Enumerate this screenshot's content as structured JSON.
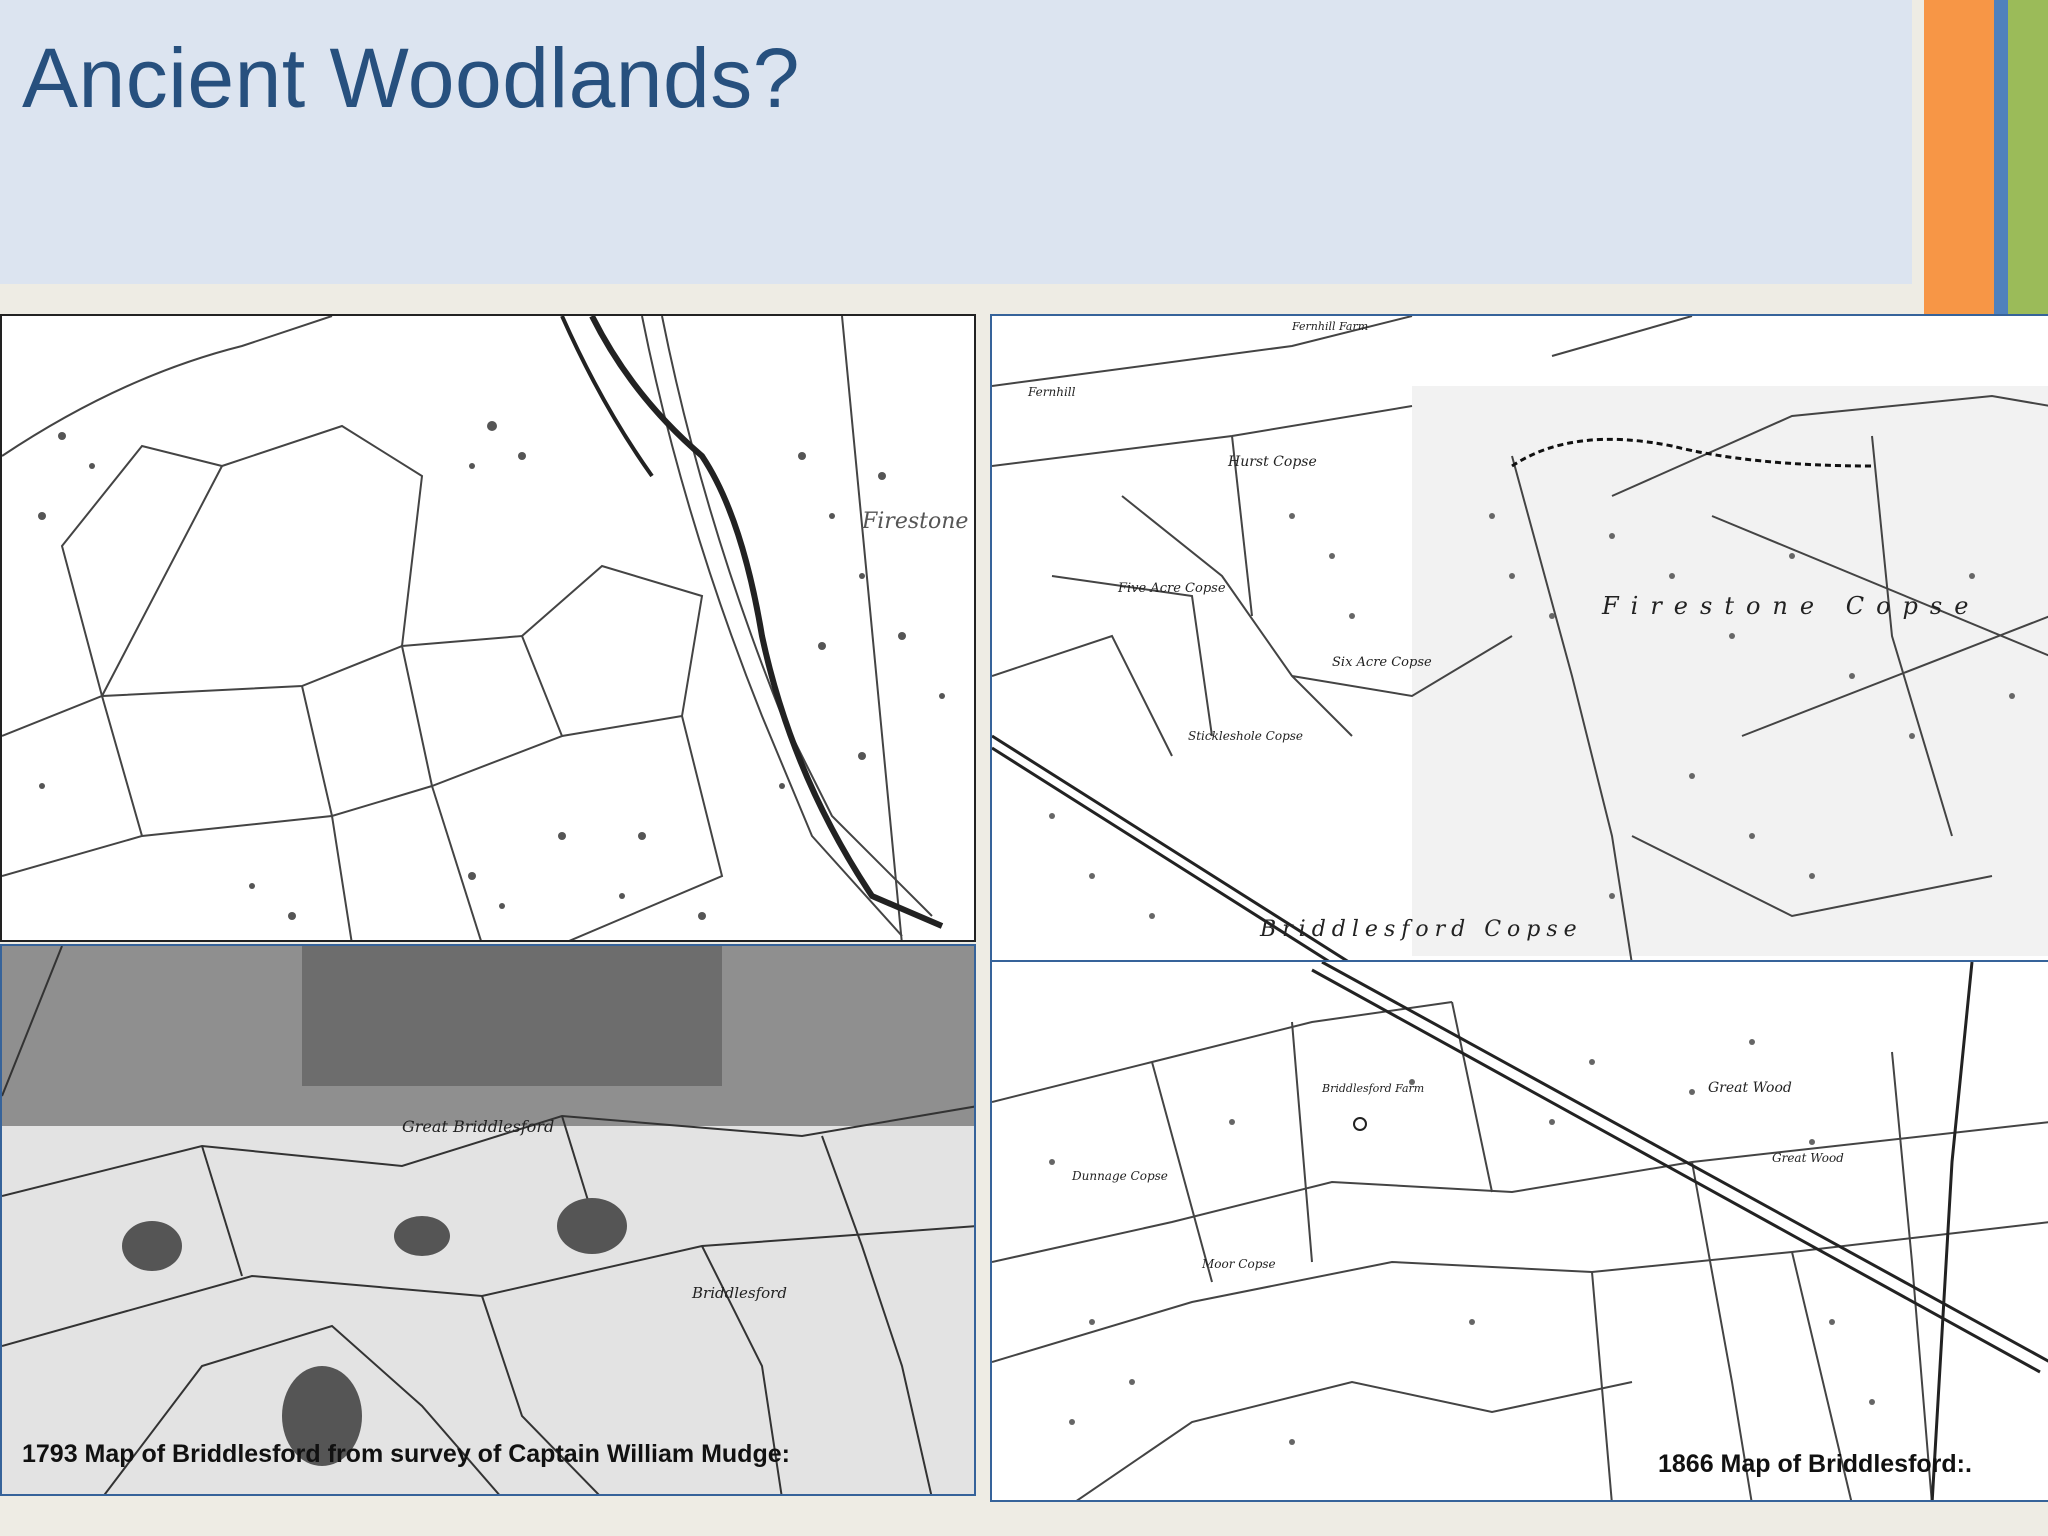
{
  "slide": {
    "title": "Ancient Woodlands?",
    "accent_colors": [
      "#f79646",
      "#4f81bd",
      "#9bbb59"
    ]
  },
  "maps": {
    "map_1793": {
      "caption": "1793 Map of Briddlesford from survey of Captain William Mudge:",
      "labels": [
        "Firestone",
        "Great Briddlesford",
        "Briddlesford"
      ]
    },
    "map_1866": {
      "caption": "1866 Map of Briddlesford:.",
      "labels": [
        "Fernhill Farm",
        "Fernhill",
        "Hurst Copse",
        "Five Acre Copse",
        "Six Acre Copse",
        "Stickleshole Copse",
        "Firestone Copse",
        "Briddlesford Copse",
        "Great Wood",
        "Briddlesford Farm",
        "Moor Copse",
        "Dunnage Copse",
        "Great Wood"
      ]
    }
  }
}
